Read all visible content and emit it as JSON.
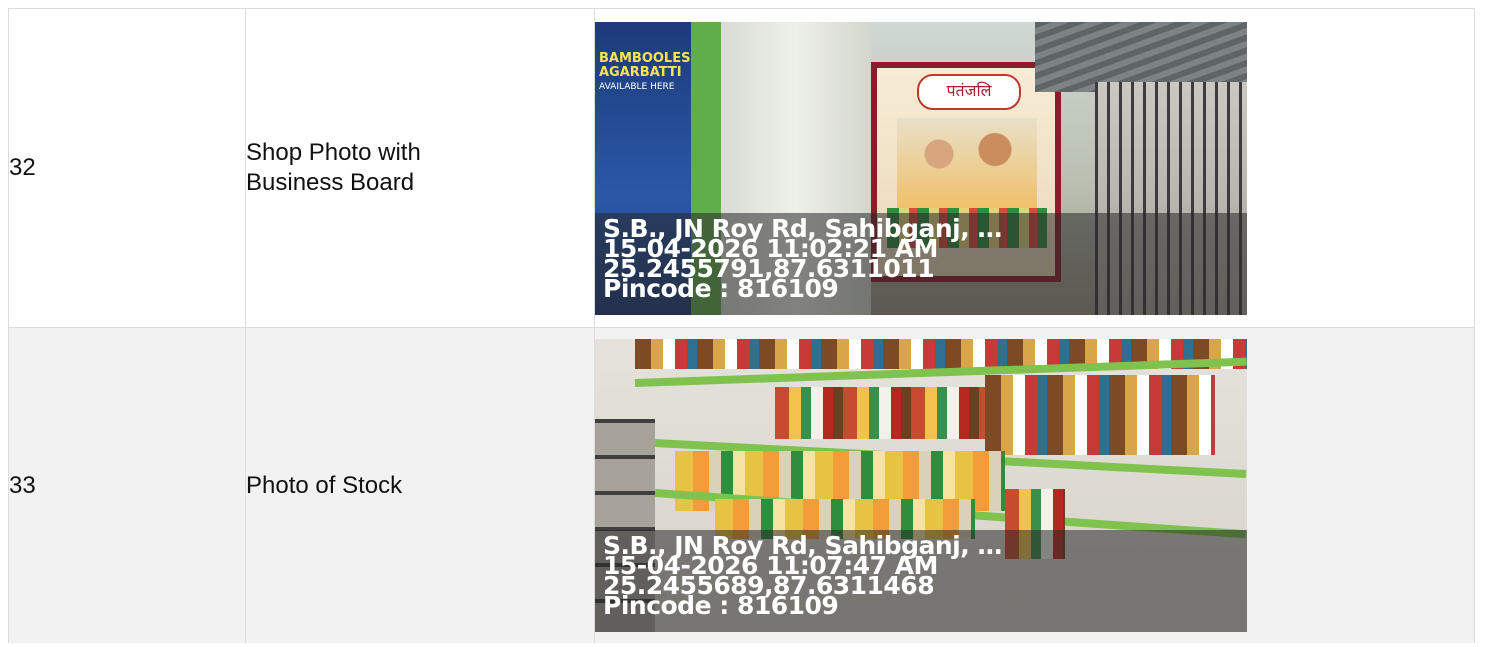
{
  "rows": [
    {
      "number": "32",
      "label": "Shop Photo with Business Board",
      "photo": {
        "poster_text_1": "BAMBOOLESS",
        "poster_text_2": "AGARBATTI",
        "poster_text_3": "AVAILABLE HERE",
        "board_title": "पतंजलि",
        "overlay": {
          "address": "S.B., JN Roy Rd, Sahibganj, …",
          "datetime": "15-04-2026 11:02:21 AM",
          "coords": "25.2455791,87.6311011",
          "pincode": "Pincode : 816109"
        }
      }
    },
    {
      "number": "33",
      "label": "Photo of Stock",
      "photo": {
        "overlay": {
          "address": "S.B., JN Roy Rd, Sahibganj, …",
          "datetime": "15-04-2026 11:07:47 AM",
          "coords": "25.2455689,87.6311468",
          "pincode": "Pincode : 816109"
        }
      }
    }
  ]
}
